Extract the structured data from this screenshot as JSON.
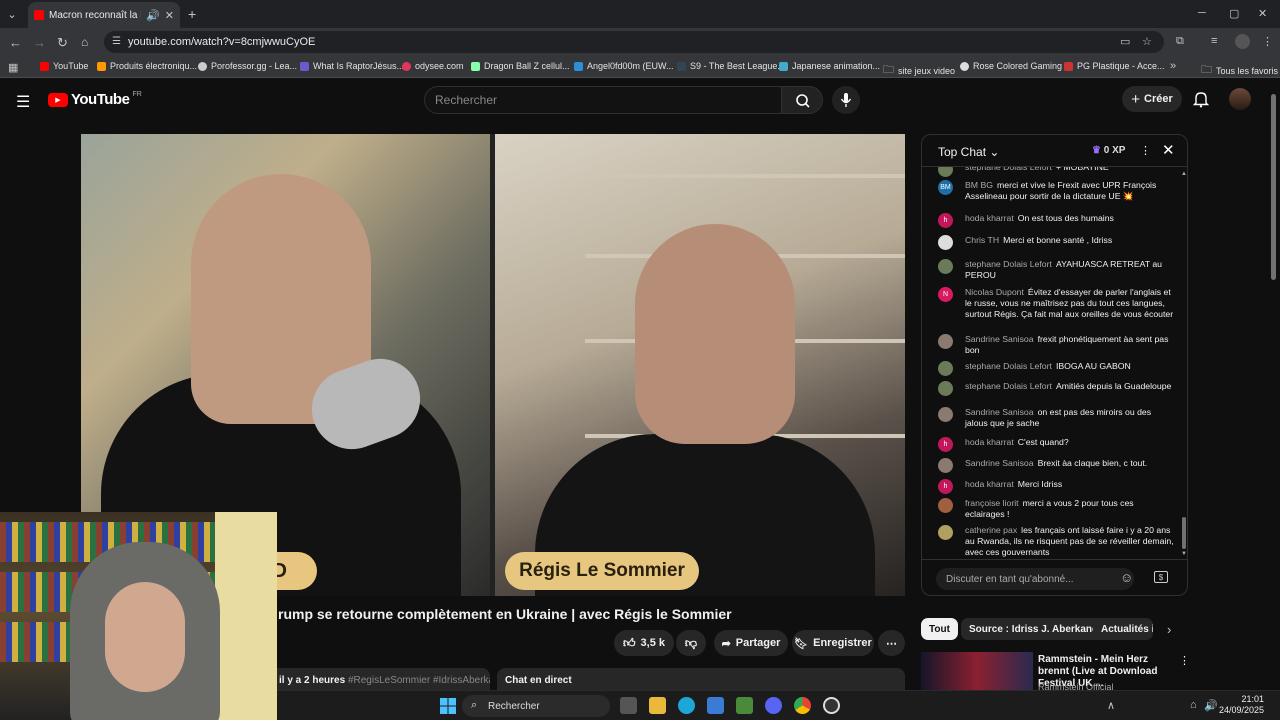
{
  "browser": {
    "tab_title": "Macron reconnaît la Palestine",
    "url": "youtube.com/watch?v=8cmjwwuCyOE",
    "bookmarks": [
      "YouTube",
      "Produits électroniqu...",
      "Porofessor.gg - Lea...",
      "What Is RaptorJésus...",
      "odysee.com",
      "Dragon Ball Z cellul...",
      "Angel0fd00m (EUW...",
      "S9 - The Best League...",
      "Japanese animation...",
      "site jeux video",
      "Rose Colored Gaming",
      "PG Plastique - Acce...",
      "Tous les favoris"
    ]
  },
  "youtube": {
    "logo_text": "YouTube",
    "logo_region": "FR",
    "search_placeholder": "Rechercher",
    "create_label": "Créer"
  },
  "video": {
    "name_left": ".D",
    "name_right": "Régis Le Sommier",
    "title": "rump se retourne complètement en Ukraine | avec Régis le Sommier",
    "likes": "3,5 k",
    "share_label": "Partager",
    "save_label": "Enregistrer",
    "desc_time": "il y a 2 heures",
    "desc_tags": "#RegisLeSommier #IdrissAberka",
    "chat_direct": "Chat en direct"
  },
  "chat": {
    "title": "Top Chat",
    "xp": "0 XP",
    "input_placeholder": "Discuter en tant qu'abonné...",
    "messages": [
      {
        "author": "stephane Dolais Lefort",
        "text": "+ MOBAYINE",
        "avatar": "",
        "color": "#6b7b5a"
      },
      {
        "author": "BM BG",
        "text": "merci et vive le Frexit avec UPR François Asselineau pour sortir de la dictature UE 💥",
        "avatar": "BM",
        "color": "#1e6fa8"
      },
      {
        "author": "hoda kharrat",
        "text": "On est tous des humains",
        "avatar": "h",
        "color": "#c2185b"
      },
      {
        "author": "Chris TH",
        "text": "Merci et bonne santé , Idriss",
        "avatar": "",
        "color": "#dddddd"
      },
      {
        "author": "stephane Dolais Lefort",
        "text": "AYAHUASCA RETREAT au PEROU",
        "avatar": "",
        "color": "#6b7b5a"
      },
      {
        "author": "Nicolas Dupont",
        "text": "Évitez d'essayer de parler l'anglais et le russe, vous ne maîtrisez pas du tout ces langues, surtout Régis. Ça fait mal aux oreilles de vous écouter",
        "avatar": "N",
        "color": "#d81b60"
      },
      {
        "author": "Sandrine Sanisoa",
        "text": "frexit phonétiquement àa sent pas bon",
        "avatar": "",
        "color": "#8a7a70"
      },
      {
        "author": "stephane Dolais Lefort",
        "text": "IBOGA AU GABON",
        "avatar": "",
        "color": "#6b7b5a"
      },
      {
        "author": "stephane Dolais Lefort",
        "text": "Amitiés depuis la Guadeloupe",
        "avatar": "",
        "color": "#6b7b5a"
      },
      {
        "author": "Sandrine Sanisoa",
        "text": "on est pas des miroirs ou des jalous que je sache",
        "avatar": "",
        "color": "#8a7a70"
      },
      {
        "author": "hoda kharrat",
        "text": "C'est quand?",
        "avatar": "h",
        "color": "#c2185b"
      },
      {
        "author": "Sandrine Sanisoa",
        "text": "Brexit àa claque bien, c tout.",
        "avatar": "",
        "color": "#8a7a70"
      },
      {
        "author": "hoda kharrat",
        "text": "Merci Idriss",
        "avatar": "h",
        "color": "#c2185b"
      },
      {
        "author": "françoise liorit",
        "text": "merci a vous 2 pour tous ces eclairages !",
        "avatar": "",
        "color": "#a06040"
      },
      {
        "author": "catherine pax",
        "text": "les français ont laissé faire i y a 20 ans au Rwanda, ils ne risquent pas de se réveiller demain, avec ces gouvernants",
        "avatar": "",
        "color": "#b0a060"
      }
    ]
  },
  "chips": [
    "Tout",
    "Source : Idriss J. Aberkane",
    "Actualités i"
  ],
  "recommendation": {
    "title": "Rammstein - Mein Herz brennt (Live at Download Festival UK ...",
    "channel": "Rammstein Official"
  },
  "taskbar": {
    "search_label": "Rechercher",
    "time": "21:01",
    "date": "24/09/2025"
  }
}
